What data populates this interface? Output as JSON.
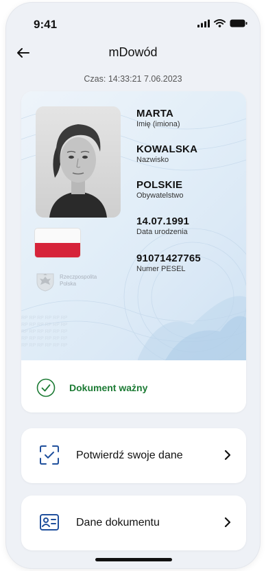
{
  "status_bar": {
    "time": "9:41"
  },
  "header": {
    "title": "mDowód"
  },
  "timestamp": "Czas: 14:33:21 7.06.2023",
  "document": {
    "emblem_text": "Rzeczpospolita Polska",
    "fields": [
      {
        "value": "MARTA",
        "label": "Imię (imiona)"
      },
      {
        "value": "KOWALSKA",
        "label": "Nazwisko"
      },
      {
        "value": "POLSKIE",
        "label": "Obywatelstwo"
      },
      {
        "value": "14.07.1991",
        "label": "Data urodzenia"
      },
      {
        "value": "91071427765",
        "label": "Numer PESEL"
      }
    ],
    "status": "Dokument ważny"
  },
  "menu": [
    {
      "label": "Potwierdź swoje dane",
      "icon": "scan-check-icon"
    },
    {
      "label": "Dane dokumentu",
      "icon": "id-card-icon"
    }
  ],
  "colors": {
    "status_green": "#1b7a33",
    "nav_blue": "#1f4f9c",
    "flag_red": "#d6243a"
  }
}
